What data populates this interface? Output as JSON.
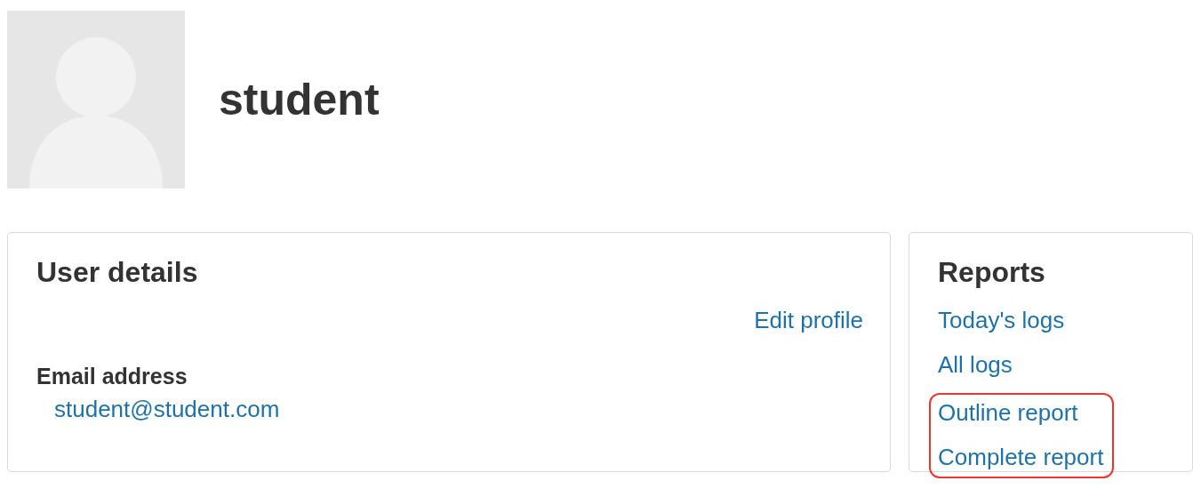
{
  "user": {
    "name": "student",
    "avatar": {
      "kind": "default-silhouette"
    }
  },
  "user_details": {
    "title": "User details",
    "edit_link": "Edit profile",
    "fields": [
      {
        "label": "Email address",
        "value": "student@student.com"
      }
    ]
  },
  "reports": {
    "title": "Reports",
    "links": [
      {
        "label": "Today's logs",
        "highlighted": false
      },
      {
        "label": "All logs",
        "highlighted": false
      },
      {
        "label": "Outline report",
        "highlighted": true
      },
      {
        "label": "Complete report",
        "highlighted": true
      }
    ]
  }
}
